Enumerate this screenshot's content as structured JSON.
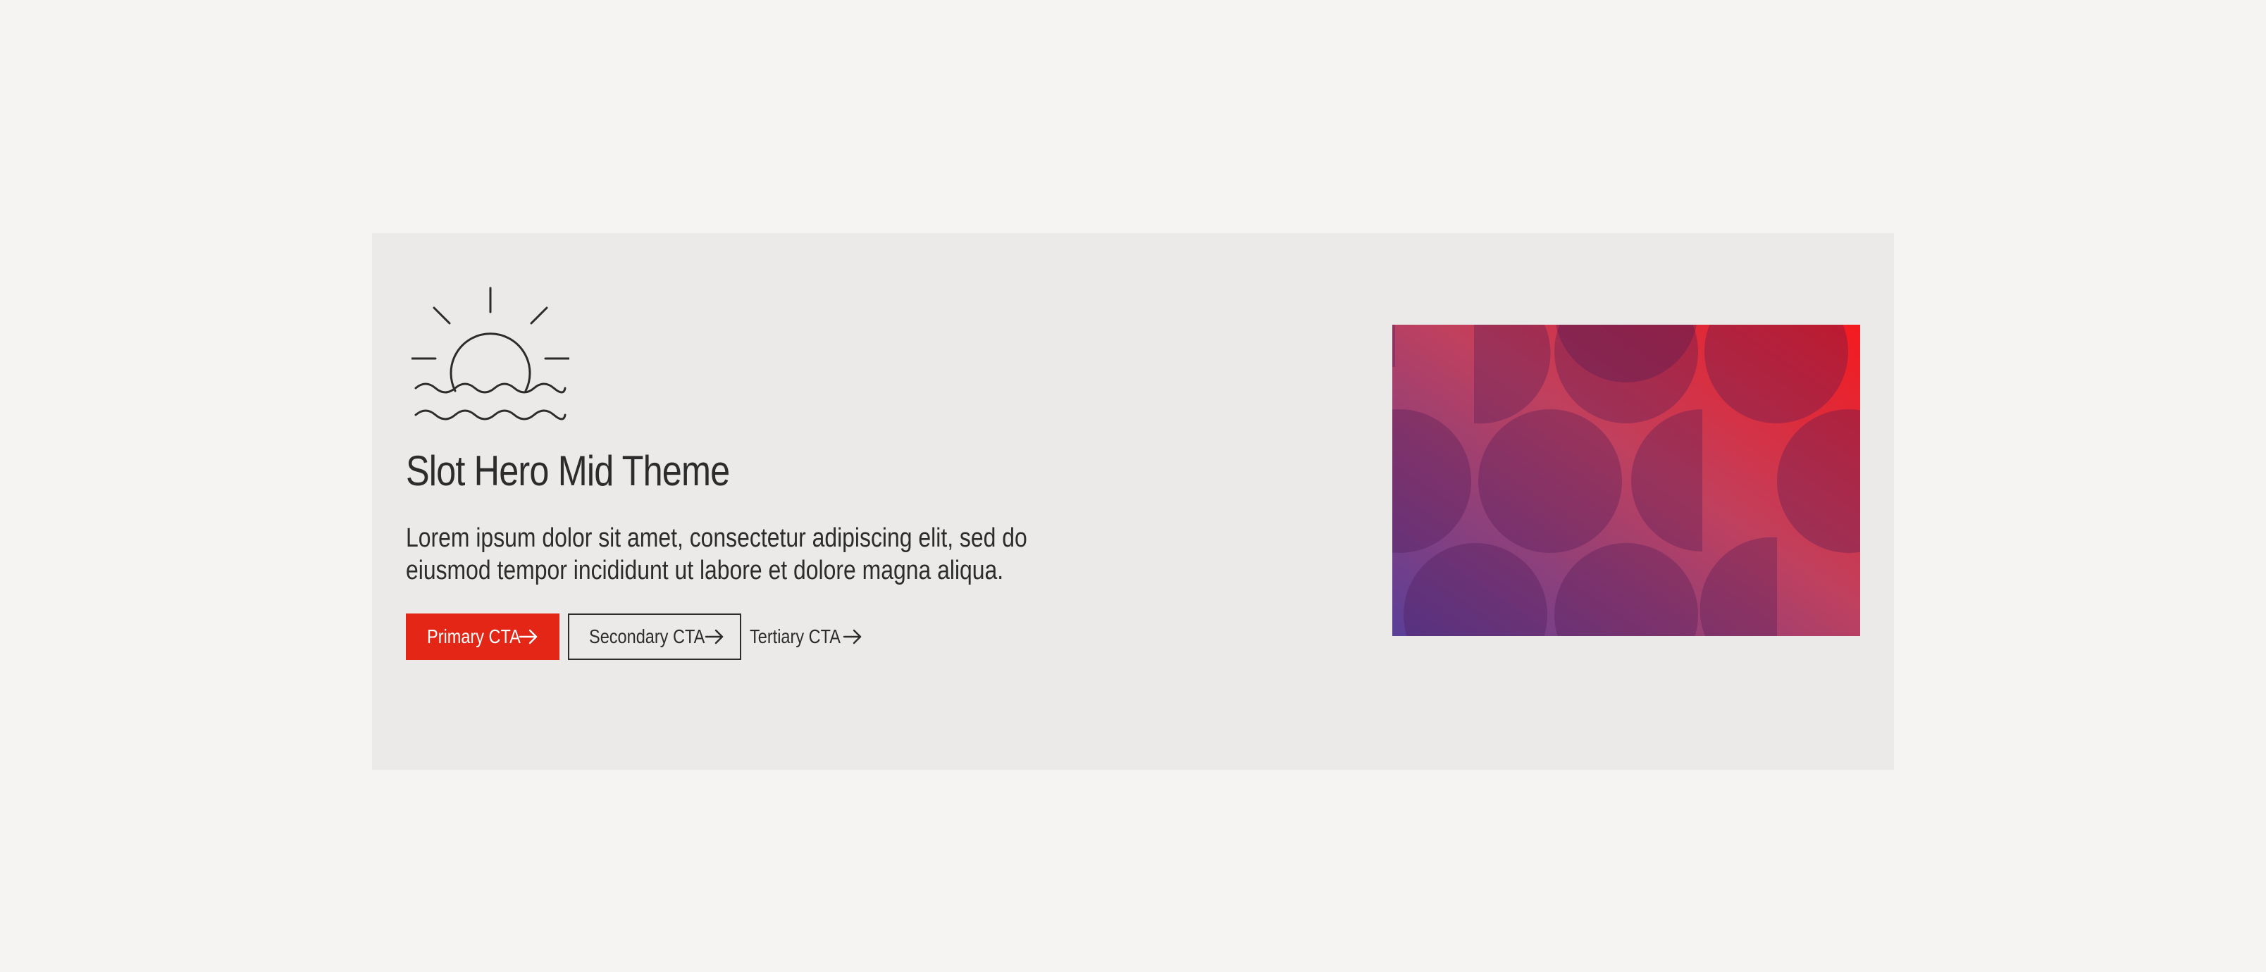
{
  "hero": {
    "title": "Slot Hero Mid Theme",
    "body_line1": "Lorem ipsum dolor sit amet, consectetur adipiscing elit, sed do",
    "body_line2": "eiusmod tempor incididunt ut labore et dolore magna aliqua.",
    "icon": "sunrise-over-water-icon",
    "ctas": {
      "primary_label": "Primary CTA",
      "secondary_label": "Secondary CTA",
      "tertiary_label": "Tertiary CTA",
      "arrow_icon": "arrow-right-icon"
    },
    "image": {
      "description_icon": "geometric-circles-pattern",
      "gradient_colors": [
        "#5b3a92",
        "#c8375c",
        "#f2121a"
      ]
    }
  },
  "colors": {
    "page_background": "#f5f4f2",
    "hero_background": "#ebeae8",
    "primary_accent": "#e32616",
    "text": "#2c2c2c"
  }
}
